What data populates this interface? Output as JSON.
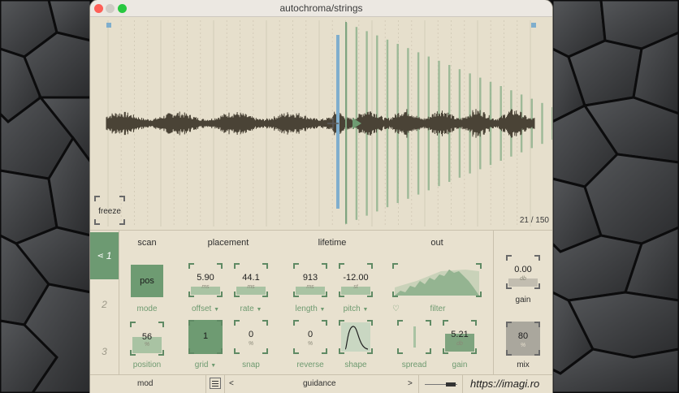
{
  "window": {
    "title": "autochroma/strings"
  },
  "wave": {
    "freeze_label": "freeze",
    "counter": "21 / 150",
    "accent": "#6e9b72",
    "playhead_color": "#7faecd"
  },
  "tabs": [
    "1",
    "2",
    "3"
  ],
  "sections": {
    "scan": "scan",
    "placement": "placement",
    "lifetime": "lifetime",
    "out": "out"
  },
  "scan": {
    "mode_value": "pos",
    "mode_label": "mode",
    "position_value": "56",
    "position_unit": "%",
    "position_label": "position",
    "position_level": 0.56
  },
  "placement": {
    "offset_value": "5.90",
    "offset_unit": "ms",
    "offset_label": "offset",
    "rate_value": "44.1",
    "rate_unit": "ms",
    "rate_label": "rate",
    "grid_value": "1",
    "grid_label": "grid",
    "snap_value": "0",
    "snap_unit": "%",
    "snap_label": "snap"
  },
  "lifetime": {
    "length_value": "913",
    "length_unit": "ms",
    "length_label": "length",
    "pitch_value": "-12.00",
    "pitch_unit": "st",
    "pitch_label": "pitch",
    "reverse_value": "0",
    "reverse_unit": "%",
    "reverse_label": "reverse",
    "shape_label": "shape"
  },
  "out": {
    "filter_label": "filter",
    "spread_label": "spread",
    "gain_value": "5.21",
    "gain_unit": "db",
    "gain_label": "gain"
  },
  "master": {
    "gain_value": "0.00",
    "gain_unit": "db",
    "gain_label": "gain",
    "mix_value": "80",
    "mix_unit": "%",
    "mix_label": "mix"
  },
  "bottom": {
    "mod_label": "mod",
    "prev": "<",
    "guidance_label": "guidance",
    "next": ">",
    "url": "https://imagi.ro"
  }
}
